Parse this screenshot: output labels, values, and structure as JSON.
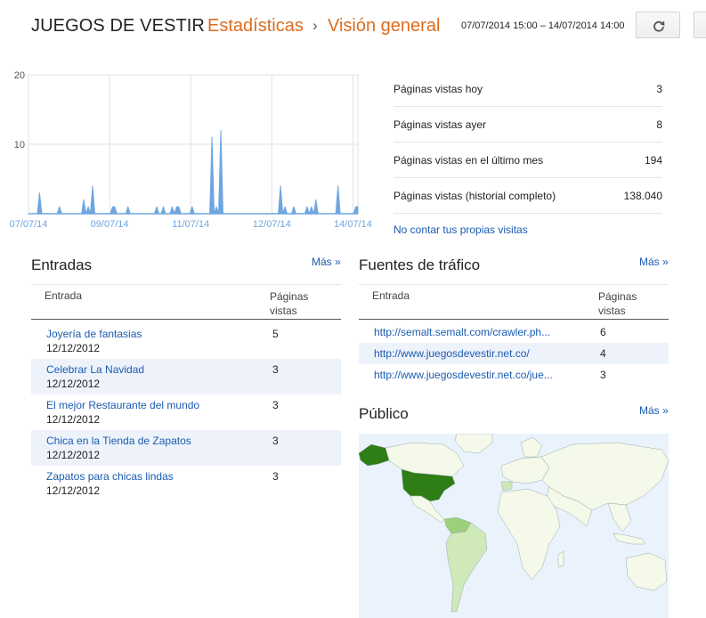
{
  "header": {
    "blog_name": "JUEGOS DE VESTIR",
    "sep1": "·",
    "section": "Estadísticas",
    "sep2": "›",
    "page": "Visión general",
    "date_range": "07/07/2014 15:00 – 14/07/2014 14:00",
    "refresh_icon": "refresh-icon"
  },
  "chart_data": {
    "type": "area",
    "x_labels": [
      "07/07/14",
      "09/07/14",
      "11/07/14",
      "12/07/14",
      "14/07/14"
    ],
    "y_ticks": [
      "20",
      "10"
    ],
    "ylim": [
      0,
      20
    ],
    "series_color": "#6fa6e0",
    "values": [
      0,
      0,
      0,
      0,
      0,
      3,
      0,
      0,
      0,
      0,
      0,
      0,
      0,
      0,
      1,
      0,
      0,
      0,
      0,
      0,
      0,
      0,
      0,
      0,
      0,
      2,
      0,
      1,
      0,
      4,
      0,
      0,
      0,
      0,
      0,
      0,
      0,
      0,
      1,
      1,
      0,
      0,
      0,
      0,
      0,
      1,
      0,
      0,
      0,
      0,
      0,
      0,
      0,
      0,
      0,
      0,
      0,
      0,
      1,
      0,
      0,
      1,
      0,
      0,
      0,
      1,
      0,
      1,
      1,
      0,
      0,
      0,
      0,
      0,
      1,
      0,
      0,
      0,
      0,
      0,
      0,
      0,
      0,
      11,
      0,
      1,
      0,
      12,
      0,
      0,
      0,
      0,
      0,
      0,
      0,
      0,
      0,
      0,
      0,
      0,
      0,
      0,
      0,
      0,
      0,
      0,
      0,
      0,
      0,
      0,
      0,
      0,
      0,
      0,
      4,
      0,
      1,
      0,
      0,
      0,
      1,
      0,
      0,
      0,
      0,
      0,
      1,
      0,
      1,
      0,
      2,
      0,
      0,
      0,
      0,
      0,
      0,
      0,
      0,
      0,
      4,
      0,
      0,
      0,
      0,
      0,
      0,
      0,
      1,
      1
    ]
  },
  "summary": {
    "rows": [
      {
        "label": "Páginas vistas hoy",
        "value": "3"
      },
      {
        "label": "Páginas vistas ayer",
        "value": "8"
      },
      {
        "label": "Páginas vistas en el último mes",
        "value": "194"
      },
      {
        "label": "Páginas vistas (historial completo)",
        "value": "138.040"
      }
    ],
    "no_count_link": "No contar tus propias visitas"
  },
  "entries": {
    "title": "Entradas",
    "more": "Más »",
    "col1": "Entrada",
    "col2_line1": "Páginas",
    "col2_line2": "vistas",
    "rows": [
      {
        "title": "Joyería de fantasias",
        "date": "12/12/2012",
        "views": "5"
      },
      {
        "title": "Celebrar La Navidad",
        "date": "12/12/2012",
        "views": "3"
      },
      {
        "title": "El mejor Restaurante del mundo",
        "date": "12/12/2012",
        "views": "3"
      },
      {
        "title": "Chica en la Tienda de Zapatos",
        "date": "12/12/2012",
        "views": "3"
      },
      {
        "title": "Zapatos para chicas lindas",
        "date": "12/12/2012",
        "views": "3"
      }
    ]
  },
  "traffic": {
    "title": "Fuentes de tráfico",
    "more": "Más »",
    "col1": "Entrada",
    "col2_line1": "Páginas",
    "col2_line2": "vistas",
    "rows": [
      {
        "url": "http://semalt.semalt.com/crawler.ph...",
        "views": "6"
      },
      {
        "url": "http://www.juegosdevestir.net.co/",
        "views": "4"
      },
      {
        "url": "http://www.juegosdevestir.net.co/jue...",
        "views": "3"
      }
    ]
  },
  "audience": {
    "title": "Público",
    "more": "Más »",
    "colors": {
      "ocean": "#eaf3fc",
      "land": "#f4f9e9",
      "high": "#2e7d15",
      "mid": "#9cd07a",
      "low": "#cfe9b8"
    }
  }
}
